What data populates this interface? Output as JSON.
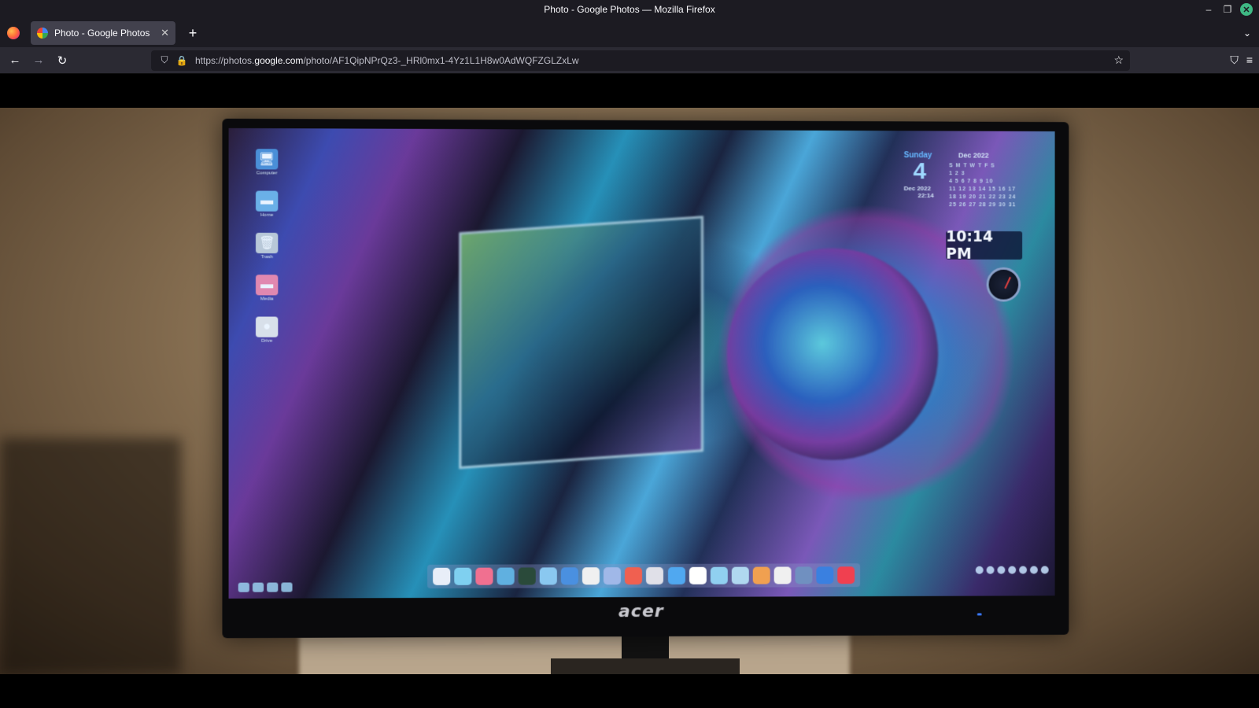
{
  "window": {
    "title": "Photo - Google Photos — Mozilla Firefox",
    "minimize_glyph": "–",
    "restore_glyph": "❐",
    "close_glyph": "✕"
  },
  "tabs": [
    {
      "label": "Photo - Google Photos",
      "close_glyph": "✕",
      "active": true
    }
  ],
  "tabstrip": {
    "new_tab_glyph": "+",
    "list_tabs_glyph": "⌄"
  },
  "navbar": {
    "back_glyph": "←",
    "forward_glyph": "→",
    "reload_glyph": "↻",
    "url_prefix": "https://photos.",
    "url_host": "google.com",
    "url_path": "/photo/AF1QipNPrQz3-_HRl0mx1-4Yz1L1H8w0AdWQFZGLZxLw",
    "bookmark_glyph": "☆",
    "pocket_glyph": "⛉",
    "menu_glyph": "≡"
  },
  "photo": {
    "desktop_icons": [
      {
        "icon": "computer-icon",
        "glyph": "🖥",
        "caption": "Computer",
        "color": "#4a8fd8"
      },
      {
        "icon": "home-folder-icon",
        "glyph": "▬",
        "caption": "Home",
        "color": "#6ab0e8"
      },
      {
        "icon": "trash-icon",
        "glyph": "🗑",
        "caption": "Trash",
        "color": "#b8c8d8"
      },
      {
        "icon": "media-folder-icon",
        "glyph": "▬",
        "caption": "Media",
        "color": "#e088b0"
      },
      {
        "icon": "drive-icon",
        "glyph": "●",
        "caption": "Drive",
        "color": "#d8e0ea"
      }
    ],
    "calendar": {
      "weekday": "Sunday",
      "day_number": "4",
      "month_label": "Dec 2022",
      "weekday_header": "S M T W T F S",
      "rows": [
        "            1 2 3",
        " 4 5 6 7 8 9 10",
        "11 12 13 14 15 16 17",
        "18 19 20 21 22 23 24",
        "25 26 27 28 29 30 31"
      ],
      "footer_date": "Dec 2022",
      "footer_time": "22:14"
    },
    "clock_text": "10:14 PM",
    "monitor_brand": "acer",
    "dock_colors": [
      "#e8eef8",
      "#7fd0f0",
      "#f07090",
      "#60b0e0",
      "#2a4a3a",
      "#8ac8f0",
      "#4a90e0",
      "#f0f0f0",
      "#a0b8e8",
      "#f06050",
      "#e0e0e8",
      "#50a8f0",
      "#ffffff",
      "#90d0f0",
      "#b0d8f0",
      "#f0a050",
      "#f0f0f0",
      "#7090c0",
      "#3a80e0",
      "#f04050"
    ],
    "accent": "#ff7139"
  }
}
